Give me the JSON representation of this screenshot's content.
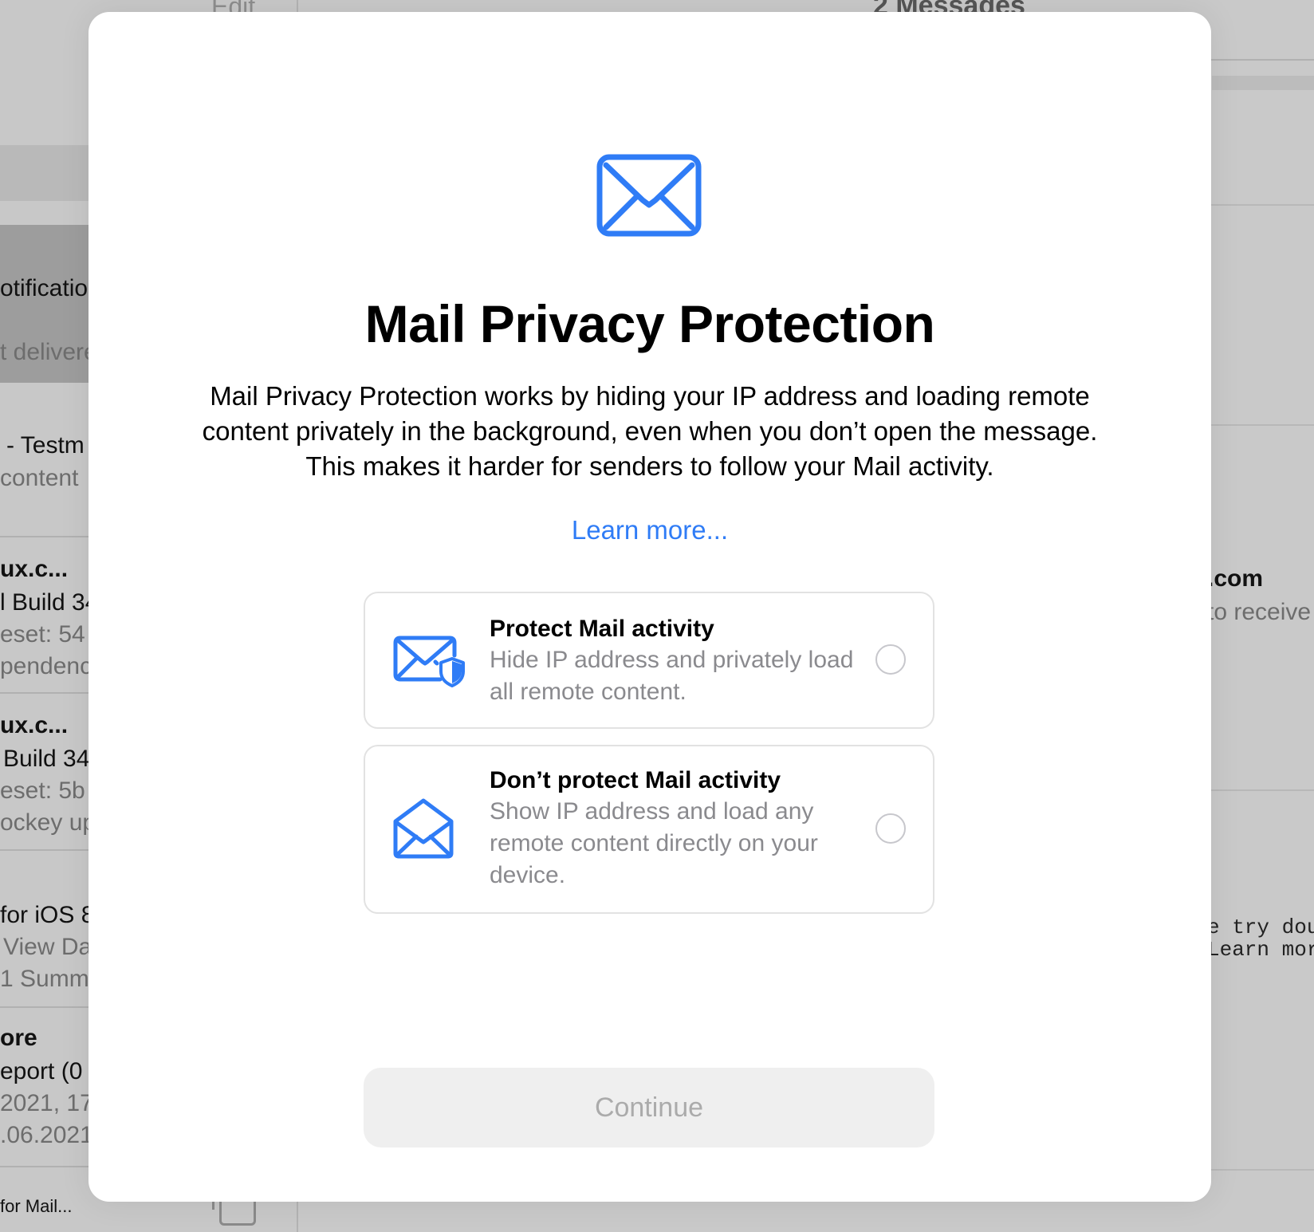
{
  "background": {
    "toolbar_edit": "Edit",
    "message_count": "2 Messages",
    "list_fragments": [
      "otificatio",
      "t delivere",
      "- Testm",
      "content",
      "ux.c...",
      "l Build 34",
      "eset: 54",
      "pendenc",
      "ux.c...",
      "Build 34",
      "eset: 5b",
      "ockey up",
      "for iOS 8",
      "View Da",
      "1 Summ",
      "ore",
      "eport (0",
      "2021, 17",
      ".06.2021",
      "for Mail..."
    ],
    "detail_fragments": [
      ".com",
      "to receive",
      "e try dou",
      "Learn mor"
    ]
  },
  "modal": {
    "icon": "envelope-icon",
    "accent_color": "#2f7cf6",
    "title": "Mail Privacy Protection",
    "description_lines": [
      "Mail Privacy Protection works by hiding your IP address and loading remote",
      "content privately in the background, even when you don’t open the message.",
      "This makes it harder for senders to follow your Mail activity."
    ],
    "learn_more": "Learn more...",
    "options": [
      {
        "icon": "envelope-shield-icon",
        "title": "Protect Mail activity",
        "subtitle_lines": [
          "Hide IP address and privately load",
          "all remote content."
        ],
        "selected": false
      },
      {
        "icon": "envelope-open-icon",
        "title": "Don’t protect Mail activity",
        "subtitle_lines": [
          "Show IP address and load any",
          "remote content directly on your",
          "device."
        ],
        "selected": false
      }
    ],
    "continue_label": "Continue",
    "continue_enabled": false
  }
}
